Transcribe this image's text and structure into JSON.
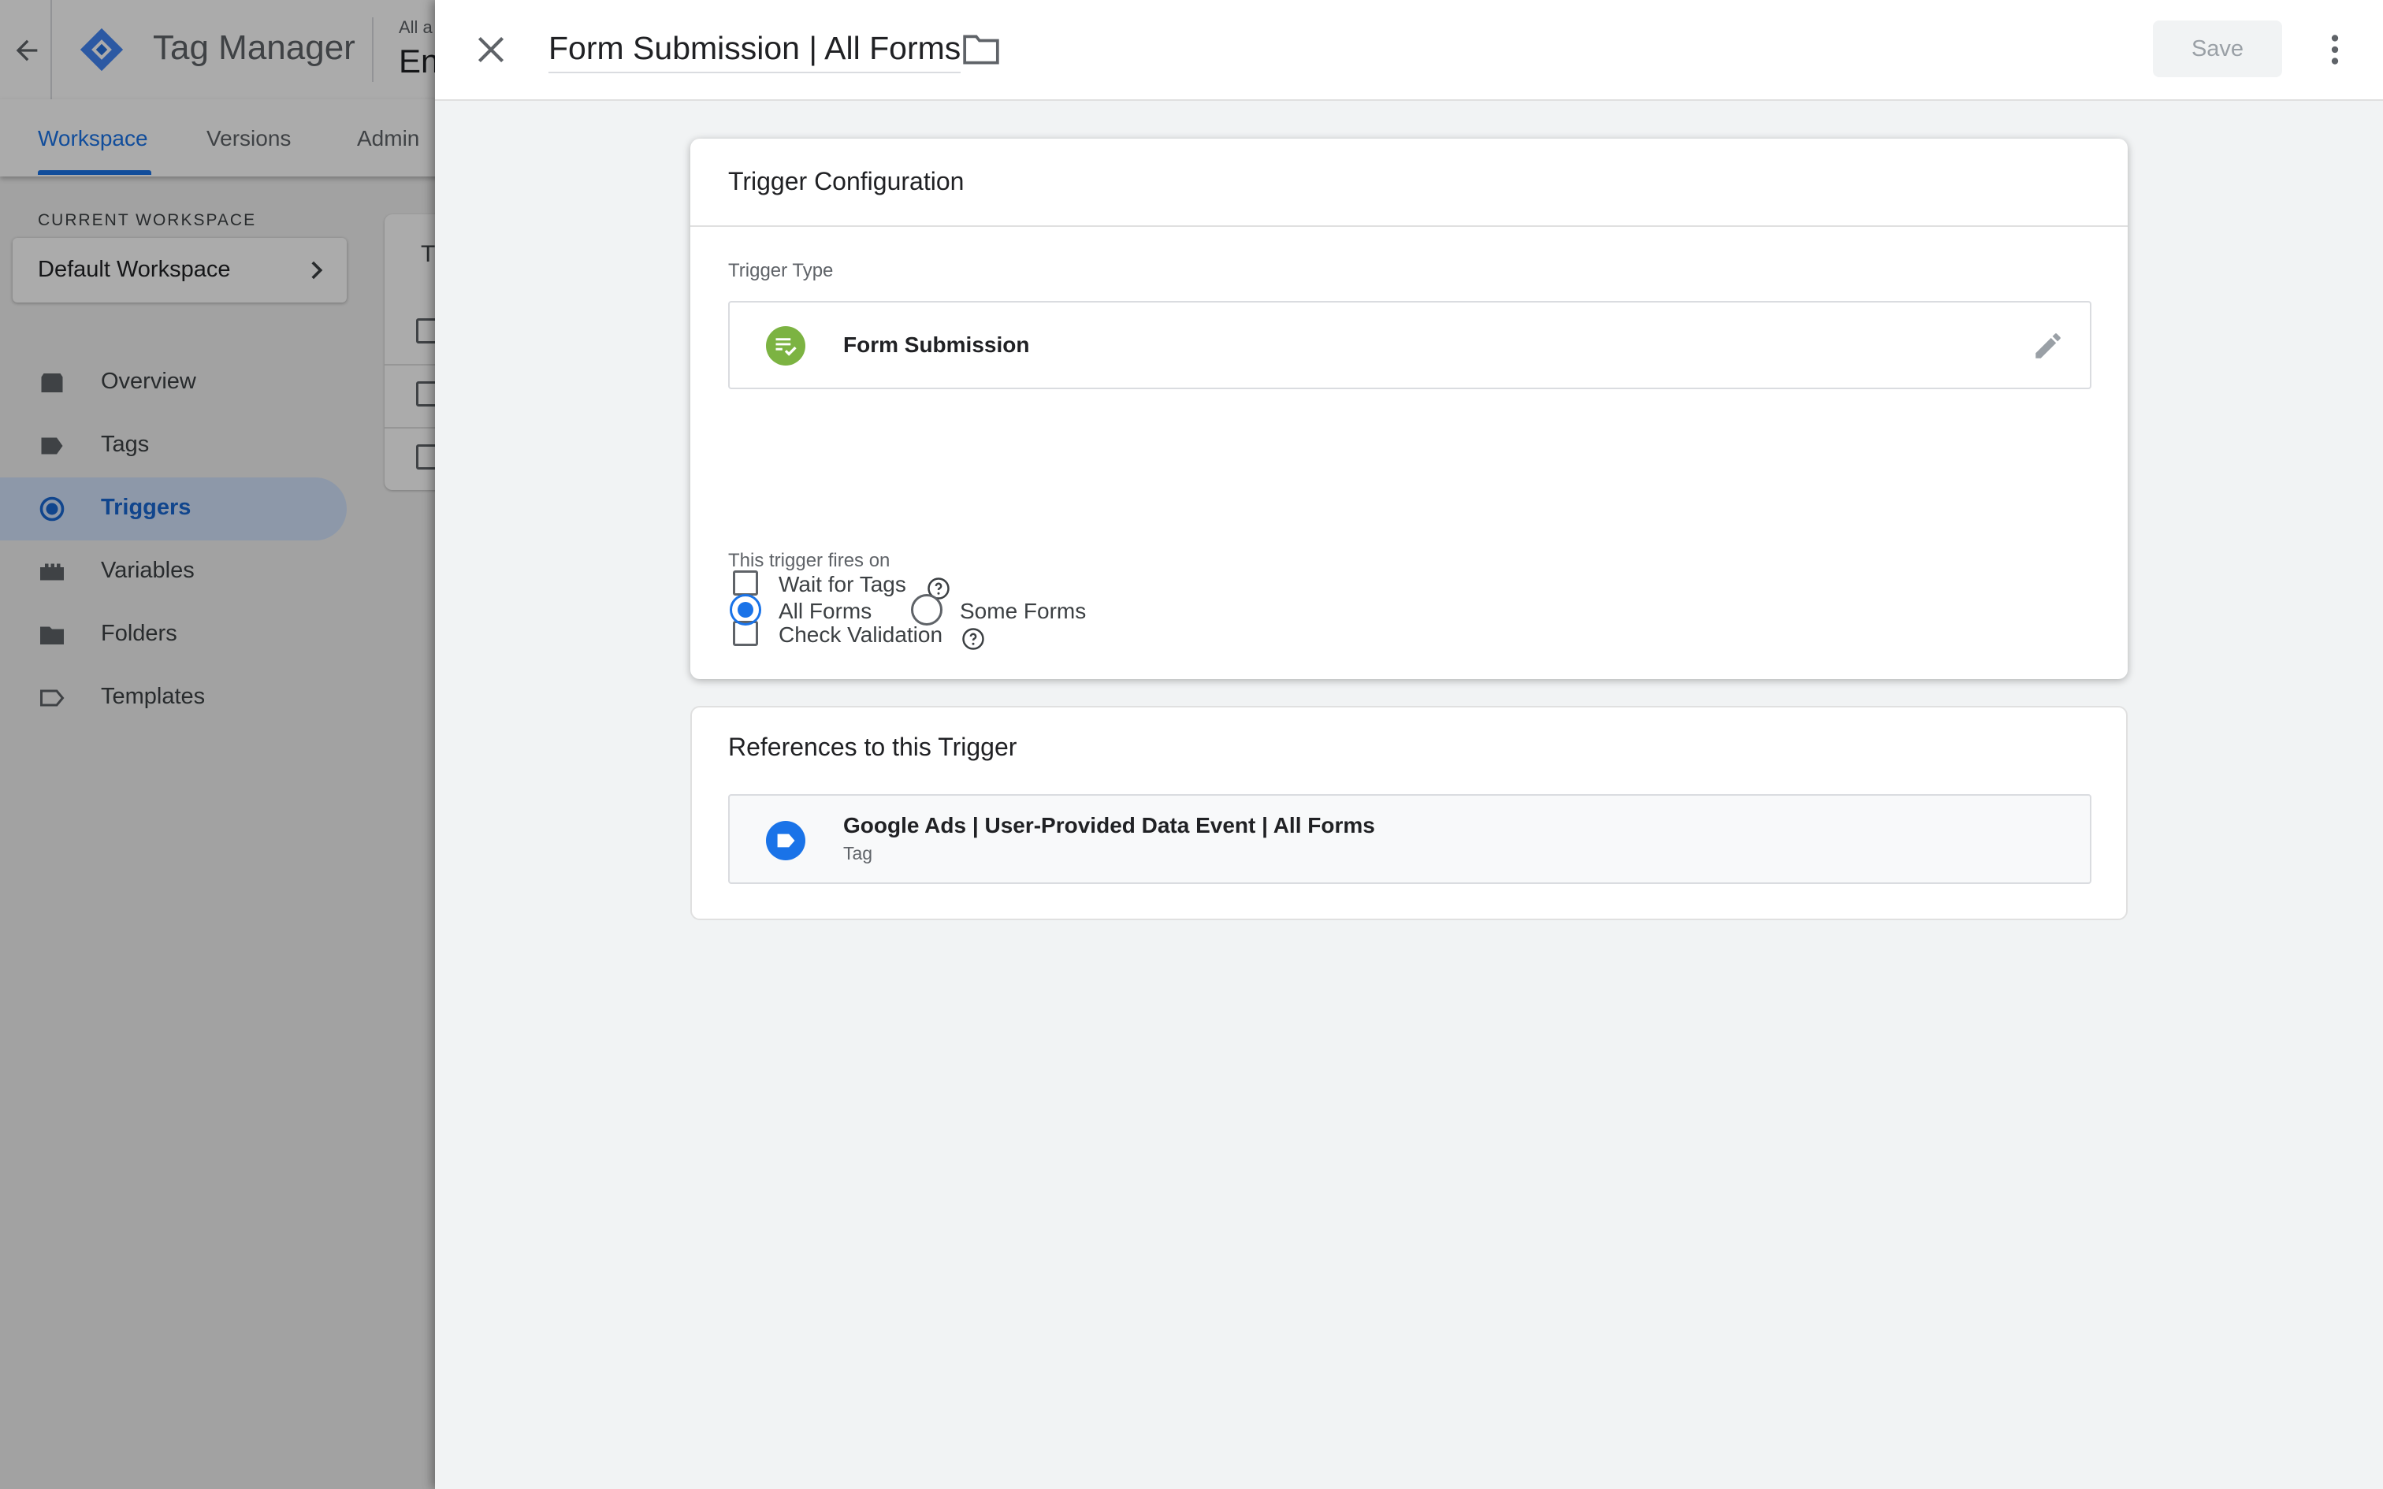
{
  "app": {
    "title": "Tag Manager",
    "account_small": "All a",
    "account_big": "En"
  },
  "tabs": [
    {
      "label": "Workspace",
      "active": true
    },
    {
      "label": "Versions",
      "active": false
    },
    {
      "label": "Admin",
      "active": false
    }
  ],
  "workspace": {
    "label": "CURRENT WORKSPACE",
    "name": "Default Workspace"
  },
  "sidebar": {
    "items": [
      {
        "label": "Overview",
        "icon": "overview-icon",
        "active": false
      },
      {
        "label": "Tags",
        "icon": "tag-icon",
        "active": false
      },
      {
        "label": "Triggers",
        "icon": "trigger-icon",
        "active": true
      },
      {
        "label": "Variables",
        "icon": "variables-icon",
        "active": false
      },
      {
        "label": "Folders",
        "icon": "folder-icon",
        "active": false
      },
      {
        "label": "Templates",
        "icon": "template-icon",
        "active": false
      }
    ]
  },
  "background_card": {
    "title_partial": "T"
  },
  "panel": {
    "title": "Form Submission | All Forms",
    "save_label": "Save"
  },
  "config": {
    "title": "Trigger Configuration",
    "type_label": "Trigger Type",
    "type_name": "Form Submission",
    "wait_for_tags": {
      "label": "Wait for Tags",
      "checked": false
    },
    "check_validation": {
      "label": "Check Validation",
      "checked": false
    },
    "fires_on_label": "This trigger fires on",
    "options": [
      {
        "label": "All Forms",
        "selected": true
      },
      {
        "label": "Some Forms",
        "selected": false
      }
    ]
  },
  "references": {
    "title": "References to this Trigger",
    "items": [
      {
        "name": "Google Ads | User-Provided Data Event | All Forms",
        "type": "Tag"
      }
    ]
  },
  "colors": {
    "accent": "#1a73e8",
    "trigger_green": "#7cb342",
    "tag_blue": "#1a73e8"
  }
}
